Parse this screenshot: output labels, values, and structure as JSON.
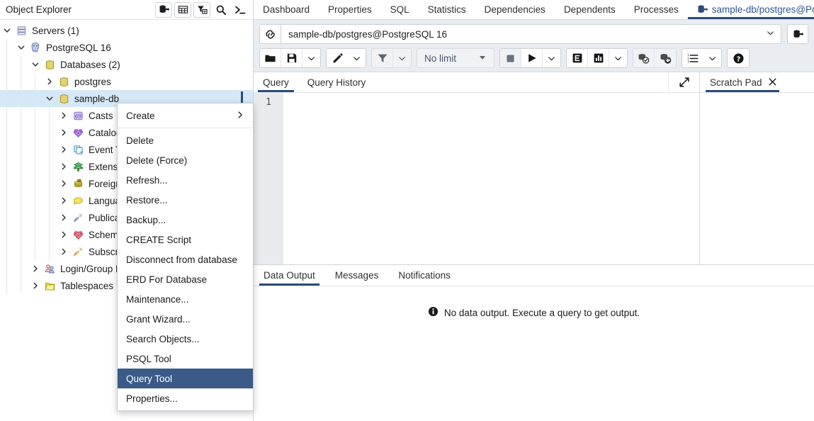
{
  "object_explorer": {
    "title": "Object Explorer",
    "tools": [
      {
        "name": "add-server-icon",
        "label": "Add New Server"
      },
      {
        "name": "table-icon",
        "label": "Object Grid"
      },
      {
        "name": "filter-table-icon",
        "label": "Filter"
      },
      {
        "name": "search-icon",
        "label": "Search Objects"
      },
      {
        "name": "terminal-icon",
        "label": "PSQL Tool"
      }
    ],
    "tree": [
      {
        "label": "Servers (1)",
        "depth": 0,
        "twisty": "down",
        "icon": "servers-icon",
        "selected": false
      },
      {
        "label": "PostgreSQL 16",
        "depth": 1,
        "twisty": "down",
        "icon": "postgres-elephant-icon",
        "selected": false
      },
      {
        "label": "Databases (2)",
        "depth": 2,
        "twisty": "down",
        "icon": "database-icon",
        "selected": false
      },
      {
        "label": "postgres",
        "depth": 3,
        "twisty": "right",
        "icon": "database-icon",
        "selected": false
      },
      {
        "label": "sample-db",
        "depth": 3,
        "twisty": "down",
        "icon": "database-icon",
        "selected": true
      },
      {
        "label": "Casts",
        "depth": 4,
        "twisty": "right",
        "icon": "casts-icon",
        "selected": false
      },
      {
        "label": "Catalogs",
        "depth": 4,
        "twisty": "right",
        "icon": "catalogs-icon",
        "selected": false
      },
      {
        "label": "Event Triggers",
        "depth": 4,
        "twisty": "right",
        "icon": "event-trigger-icon",
        "selected": false
      },
      {
        "label": "Extensions",
        "depth": 4,
        "twisty": "right",
        "icon": "extensions-icon",
        "selected": false
      },
      {
        "label": "Foreign Data Wrappers",
        "depth": 4,
        "twisty": "right",
        "icon": "foreign-data-wrapper-icon",
        "selected": false
      },
      {
        "label": "Languages",
        "depth": 4,
        "twisty": "right",
        "icon": "languages-icon",
        "selected": false
      },
      {
        "label": "Publications",
        "depth": 4,
        "twisty": "right",
        "icon": "publications-icon",
        "selected": false
      },
      {
        "label": "Schemas",
        "depth": 4,
        "twisty": "right",
        "icon": "schemas-icon",
        "selected": false
      },
      {
        "label": "Subscriptions",
        "depth": 4,
        "twisty": "right",
        "icon": "subscriptions-icon",
        "selected": false
      },
      {
        "label": "Login/Group Roles",
        "depth": 2,
        "twisty": "right",
        "icon": "roles-icon",
        "selected": false
      },
      {
        "label": "Tablespaces",
        "depth": 2,
        "twisty": "right",
        "icon": "tablespaces-icon",
        "selected": false
      }
    ]
  },
  "context_menu": {
    "items": [
      {
        "label": "Create",
        "submenu": true,
        "separator_after": true,
        "active": false
      },
      {
        "label": "Delete",
        "submenu": false,
        "separator_after": false,
        "active": false
      },
      {
        "label": "Delete (Force)",
        "submenu": false,
        "separator_after": false,
        "active": false
      },
      {
        "label": "Refresh...",
        "submenu": false,
        "separator_after": false,
        "active": false
      },
      {
        "label": "Restore...",
        "submenu": false,
        "separator_after": false,
        "active": false
      },
      {
        "label": "Backup...",
        "submenu": false,
        "separator_after": false,
        "active": false
      },
      {
        "label": "CREATE Script",
        "submenu": false,
        "separator_after": false,
        "active": false
      },
      {
        "label": "Disconnect from database",
        "submenu": false,
        "separator_after": false,
        "active": false
      },
      {
        "label": "ERD For Database",
        "submenu": false,
        "separator_after": false,
        "active": false
      },
      {
        "label": "Maintenance...",
        "submenu": false,
        "separator_after": false,
        "active": false
      },
      {
        "label": "Grant Wizard...",
        "submenu": false,
        "separator_after": false,
        "active": false
      },
      {
        "label": "Search Objects...",
        "submenu": false,
        "separator_after": false,
        "active": false
      },
      {
        "label": "PSQL Tool",
        "submenu": false,
        "separator_after": false,
        "active": false
      },
      {
        "label": "Query Tool",
        "submenu": false,
        "separator_after": false,
        "active": true
      },
      {
        "label": "Properties...",
        "submenu": false,
        "separator_after": false,
        "active": false
      }
    ],
    "highlight_color": "#3b5a88"
  },
  "main_tabs": [
    {
      "label": "Dashboard",
      "active": false,
      "icon": null
    },
    {
      "label": "Properties",
      "active": false,
      "icon": null
    },
    {
      "label": "SQL",
      "active": false,
      "icon": null
    },
    {
      "label": "Statistics",
      "active": false,
      "icon": null
    },
    {
      "label": "Dependencies",
      "active": false,
      "icon": null
    },
    {
      "label": "Dependents",
      "active": false,
      "icon": null
    },
    {
      "label": "Processes",
      "active": false,
      "icon": null
    },
    {
      "label": "sample-db/postgres@Pos",
      "active": true,
      "icon": "query-tool-icon"
    }
  ],
  "query_toolbar": {
    "connection": {
      "icon": "connection-icon",
      "value": "sample-db/postgres@PostgreSQL 16",
      "caret": "chevron-down-icon",
      "manage_icon": "manage-connections-icon"
    },
    "buttons": [
      {
        "name": "open-file-button",
        "icon": "folder-icon",
        "label": ""
      },
      {
        "name": "save-file-button",
        "icon": "save-icon",
        "label": ""
      },
      {
        "name": "save-file-dropdown",
        "icon": "chevron-down-icon",
        "label": ""
      },
      {
        "name": "edit-button",
        "icon": "pencil-icon",
        "label": ""
      },
      {
        "name": "edit-dropdown",
        "icon": "chevron-down-icon",
        "label": ""
      },
      {
        "name": "filter-button",
        "icon": "filter-icon",
        "label": ""
      },
      {
        "name": "filter-dropdown",
        "icon": "chevron-down-icon",
        "label": ""
      },
      {
        "name": "row-limit-select",
        "icon": "caret-down-icon",
        "label": "No limit"
      },
      {
        "name": "stop-button",
        "icon": "stop-icon",
        "label": ""
      },
      {
        "name": "execute-button",
        "icon": "play-icon",
        "label": ""
      },
      {
        "name": "execute-dropdown",
        "icon": "chevron-down-icon",
        "label": ""
      },
      {
        "name": "explain-button",
        "icon": "explain-icon",
        "label": "E"
      },
      {
        "name": "explain-analyze-button",
        "icon": "explain-analyze-icon",
        "label": ""
      },
      {
        "name": "explain-options-dropdown",
        "icon": "chevron-down-icon",
        "label": ""
      },
      {
        "name": "commit-button",
        "icon": "commit-icon",
        "label": ""
      },
      {
        "name": "rollback-button",
        "icon": "rollback-icon",
        "label": ""
      },
      {
        "name": "macros-button",
        "icon": "list-icon",
        "label": ""
      },
      {
        "name": "help-button",
        "icon": "help-icon",
        "label": ""
      }
    ],
    "row_limit": "No limit"
  },
  "editor": {
    "tabs": [
      {
        "label": "Query",
        "active": true
      },
      {
        "label": "Query History",
        "active": false
      }
    ],
    "expand_icon": "expand-icon",
    "line_numbers": [
      "1"
    ],
    "content": ""
  },
  "scratch_pad": {
    "title": "Scratch Pad",
    "close_icon": "close-icon",
    "content": ""
  },
  "output": {
    "tabs": [
      {
        "label": "Data Output",
        "active": true
      },
      {
        "label": "Messages",
        "active": false
      },
      {
        "label": "Notifications",
        "active": false
      }
    ],
    "empty_message": "No data output. Execute a query to get output.",
    "empty_icon": "info-icon"
  },
  "colors": {
    "accent": "#2c4b7c",
    "selection": "#d5e8f7",
    "menu_highlight": "#3b5a88",
    "toolbar_bg": "#e9ecf0"
  }
}
